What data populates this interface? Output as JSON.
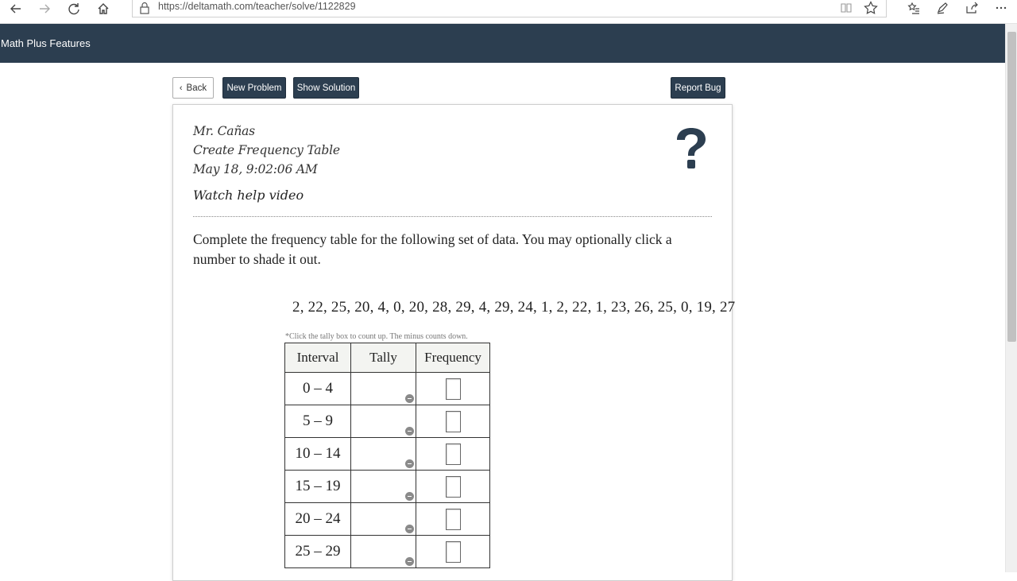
{
  "browser": {
    "url": "https://deltamath.com/teacher/solve/1122829",
    "icons": [
      "back-arrow-icon",
      "forward-arrow-icon",
      "refresh-icon",
      "home-icon",
      "lock-icon",
      "reading-view-icon",
      "star-icon",
      "favorites-icon",
      "pen-icon",
      "share-icon",
      "more-icon"
    ]
  },
  "header": {
    "brand": "Math Plus Features",
    "background": "#2c3e50"
  },
  "toolbar": {
    "back_label": "Back",
    "new_problem_label": "New Problem",
    "show_solution_label": "Show Solution",
    "report_bug_label": "Report Bug"
  },
  "problem": {
    "teacher": "Mr. Cañas",
    "title": "Create Frequency Table",
    "date": "May 18, 9:02:06 AM",
    "help_link": "Watch help video",
    "prompt": "Complete the frequency table for the following set of data. You may optionally click a number to shade it out.",
    "dataset": [
      2,
      22,
      25,
      20,
      4,
      0,
      20,
      28,
      29,
      4,
      29,
      24,
      1,
      2,
      22,
      1,
      23,
      26,
      25,
      0,
      19,
      27
    ],
    "note": "*Click the tally box to count up. The minus counts down.",
    "table": {
      "headers": [
        "Interval",
        "Tally",
        "Frequency"
      ],
      "intervals": [
        "0 – 4",
        "5 – 9",
        "10 – 14",
        "15 – 19",
        "20 – 24",
        "25 – 29"
      ]
    }
  }
}
